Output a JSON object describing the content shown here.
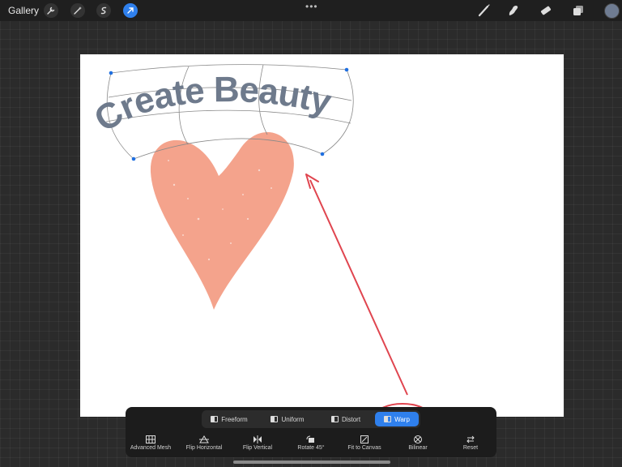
{
  "topbar": {
    "gallery": "Gallery",
    "tools": [
      "wrench-icon",
      "magic-wand-icon",
      "selection-icon",
      "transform-arrow-icon"
    ],
    "right_tools": [
      "brush-icon",
      "smudge-icon",
      "eraser-icon",
      "layers-icon"
    ],
    "more": "•••"
  },
  "canvas": {
    "text": "Create Beauty",
    "text_color": "#6e7a8c",
    "heart_color": "#f4a38c",
    "annotation_color": "#e0454f"
  },
  "transform": {
    "modes": [
      {
        "label": "Freeform",
        "active": false
      },
      {
        "label": "Uniform",
        "active": false
      },
      {
        "label": "Distort",
        "active": false
      },
      {
        "label": "Warp",
        "active": true
      }
    ],
    "actions": [
      {
        "label": "Advanced Mesh",
        "icon": "mesh-icon"
      },
      {
        "label": "Flip Horizontal",
        "icon": "flip-horizontal-icon"
      },
      {
        "label": "Flip Vertical",
        "icon": "flip-vertical-icon"
      },
      {
        "label": "Rotate 45°",
        "icon": "rotate-icon"
      },
      {
        "label": "Fit to Canvas",
        "icon": "fit-canvas-icon"
      },
      {
        "label": "Bilinear",
        "icon": "bilinear-icon"
      },
      {
        "label": "Reset",
        "icon": "reset-icon"
      }
    ],
    "accent": "#2f80ed"
  }
}
